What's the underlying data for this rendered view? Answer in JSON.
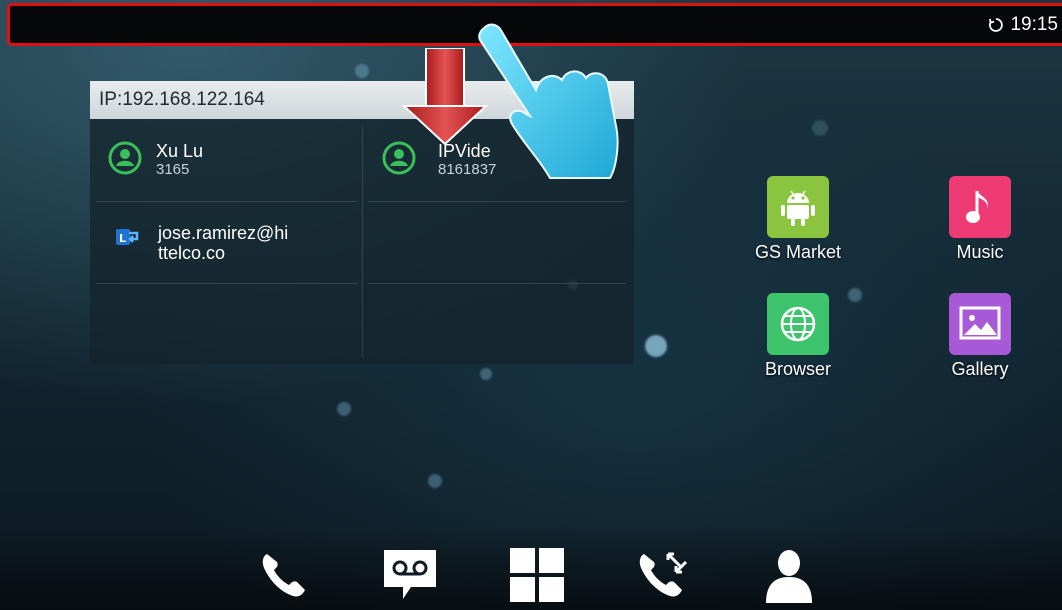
{
  "status_bar": {
    "time": "19:15",
    "icons": [
      "sync-icon"
    ]
  },
  "widget": {
    "header": "IP:192.168.122.164",
    "contacts": [
      {
        "name": "Xu Lu",
        "number": "3165",
        "icon": "contact-icon"
      },
      {
        "name": "IPVide",
        "number": "8161837",
        "icon": "contact-icon"
      },
      {
        "name_line1": "jose.ramirez@hi",
        "name_line2": "ttelco.co",
        "icon": "lync-icon"
      }
    ]
  },
  "apps": [
    {
      "label": "GS Market",
      "icon": "android-icon",
      "color": "#8bc53f"
    },
    {
      "label": "Music",
      "icon": "music-note-icon",
      "color": "#ee3b73"
    },
    {
      "label": "Browser",
      "icon": "globe-icon",
      "color": "#3ec46d"
    },
    {
      "label": "Gallery",
      "icon": "picture-icon",
      "color": "#a85ad6"
    }
  ],
  "dock": [
    "phone-icon",
    "voicemail-icon",
    "apps-grid-icon",
    "call-transfer-icon",
    "contacts-icon"
  ],
  "colors": {
    "highlight": "#e01010",
    "arrow": "#c62828"
  }
}
